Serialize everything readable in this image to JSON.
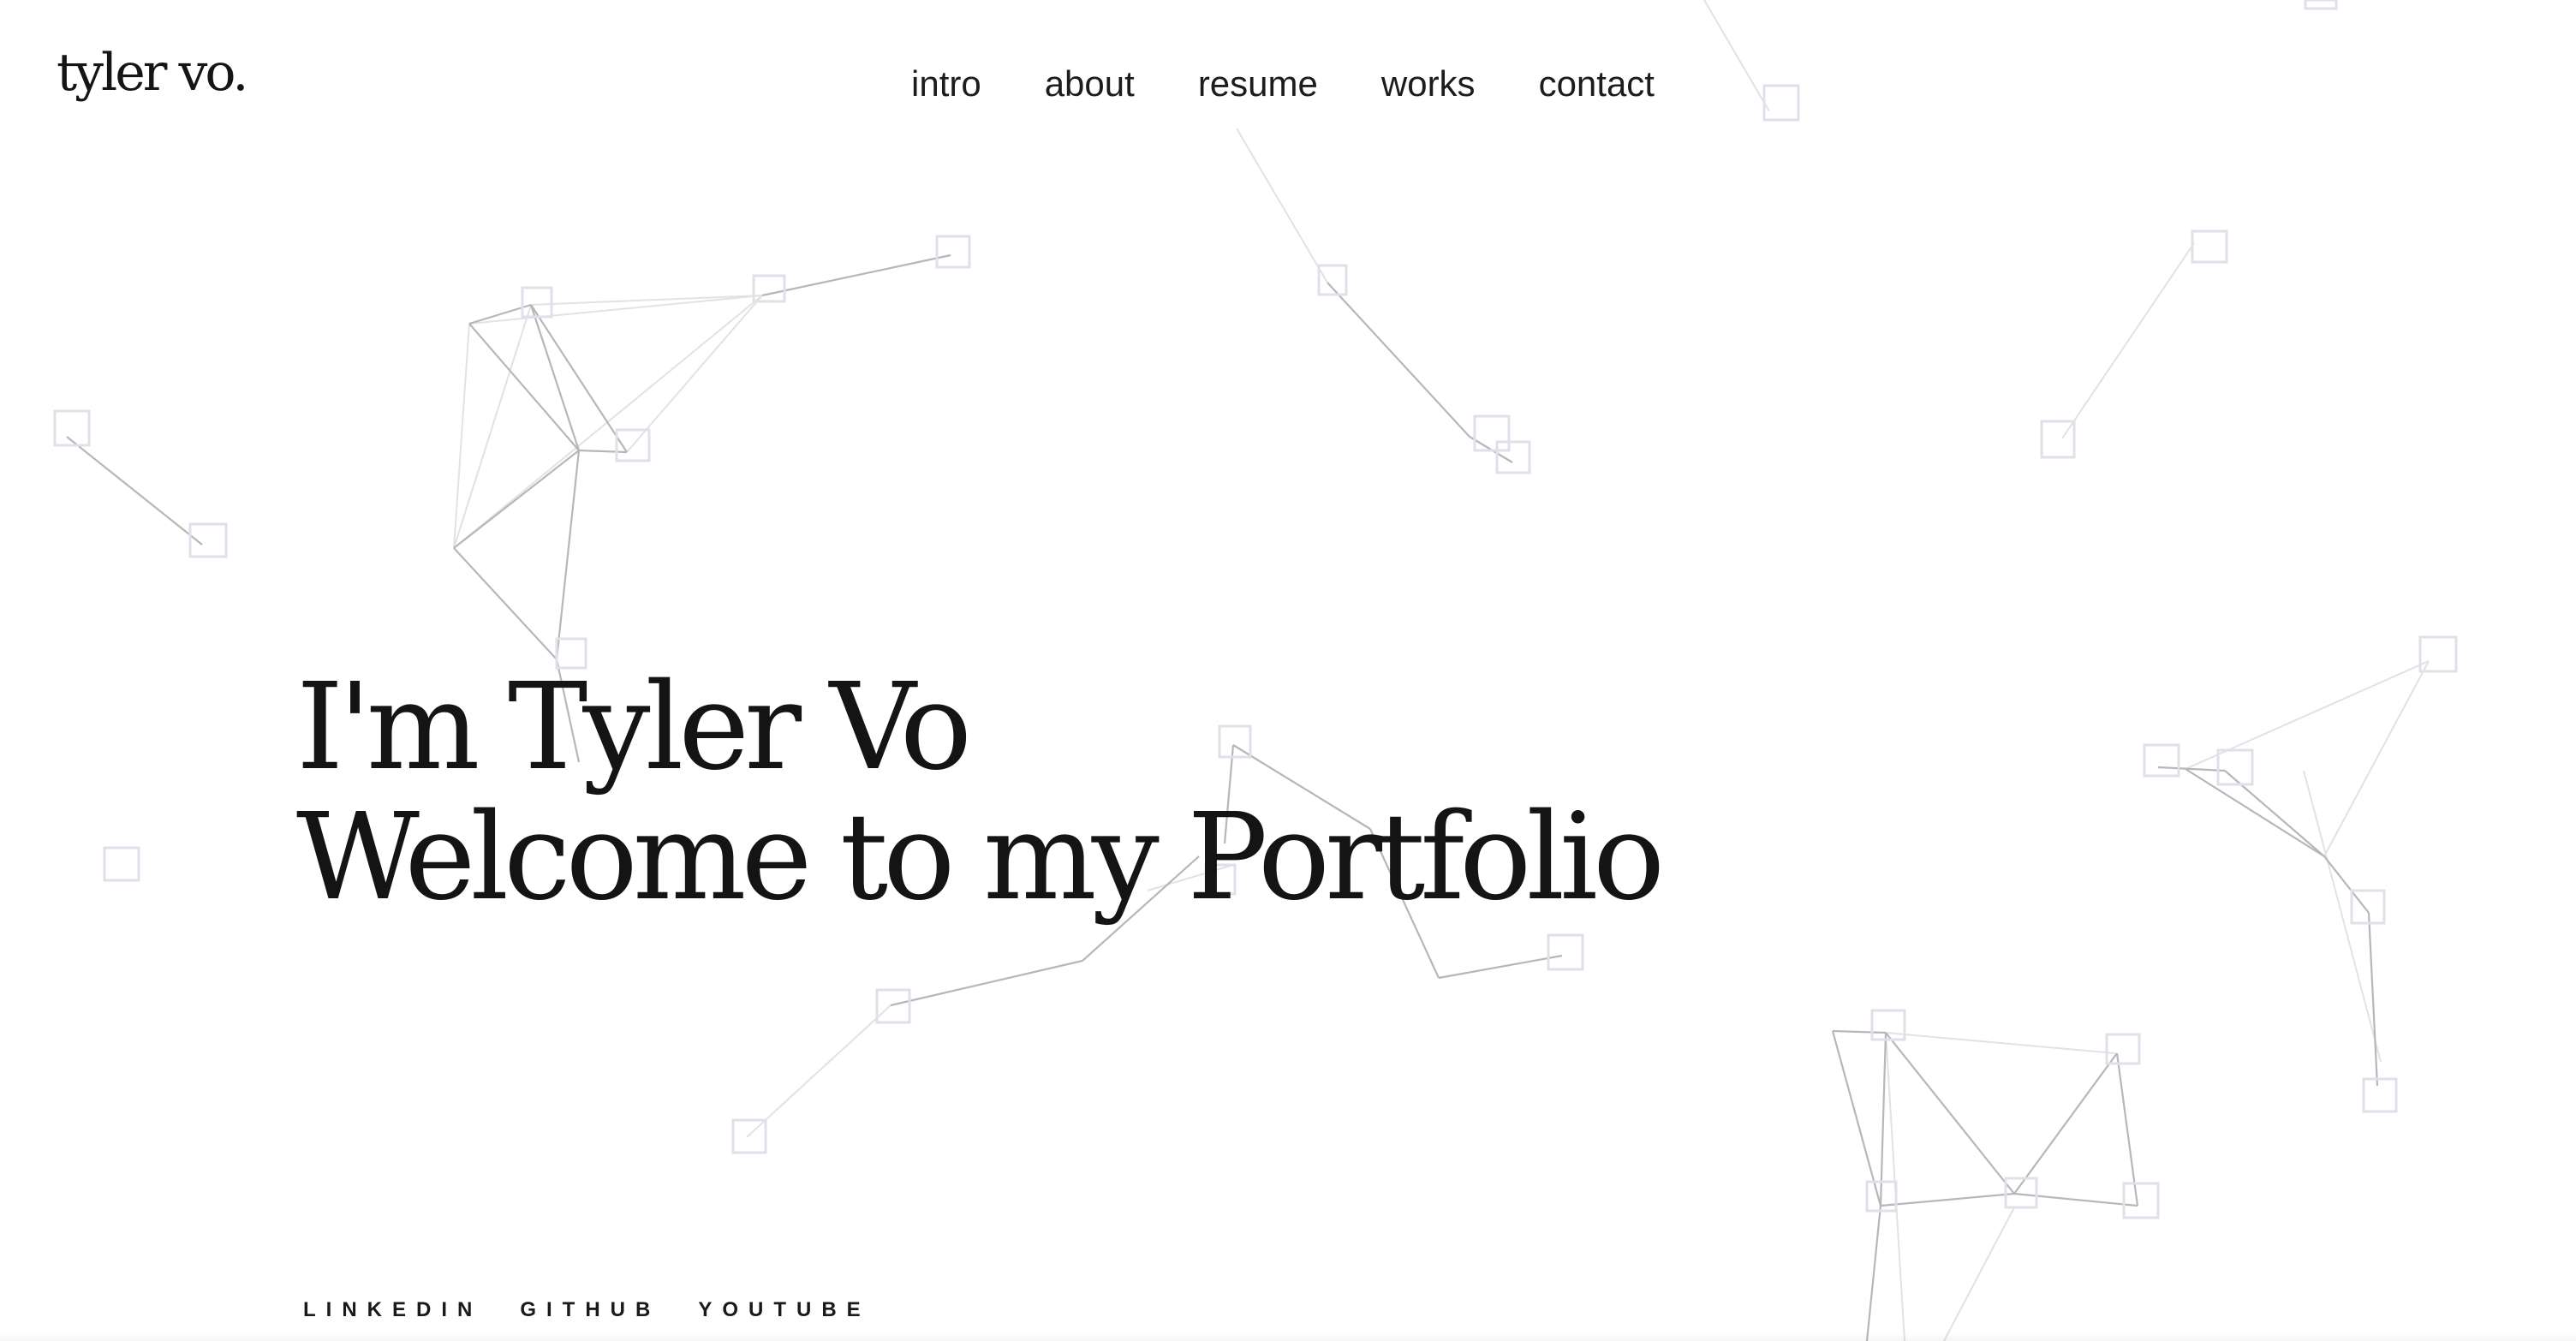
{
  "brand": {
    "logo_text": "tyler vo."
  },
  "nav": {
    "items": [
      {
        "label": "intro"
      },
      {
        "label": "about"
      },
      {
        "label": "resume"
      },
      {
        "label": "works"
      },
      {
        "label": "contact"
      }
    ]
  },
  "hero": {
    "line1": "I'm Tyler Vo",
    "line2": "Welcome to my Portfolio"
  },
  "social": {
    "links": [
      {
        "label": "LINKEDIN"
      },
      {
        "label": "GITHUB"
      },
      {
        "label": "YOUTUBE"
      }
    ]
  },
  "colors": {
    "background": "#ffffff",
    "text": "#151515",
    "network_line": "#b9b9b9",
    "network_node": "#dcdce6"
  }
}
